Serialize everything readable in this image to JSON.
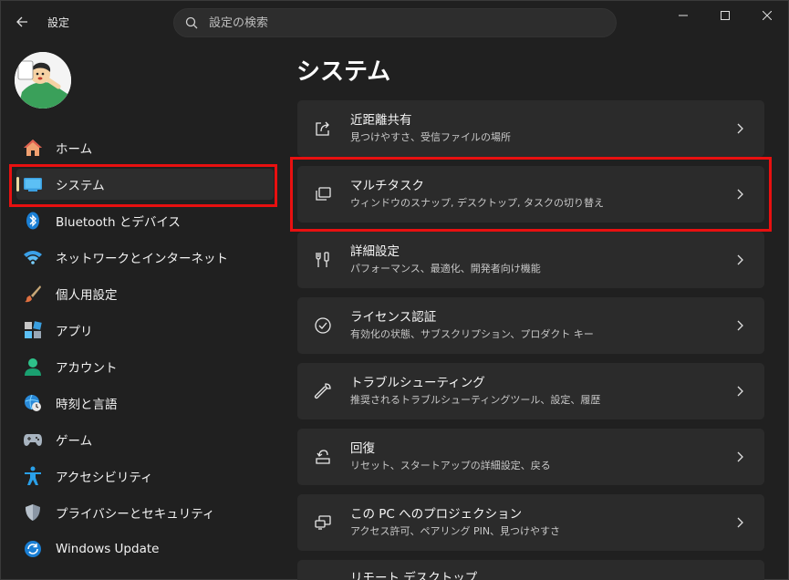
{
  "window": {
    "title": "設定",
    "search_placeholder": "設定の検索"
  },
  "sidebar": {
    "items": [
      {
        "label": "ホーム",
        "icon": "home-icon"
      },
      {
        "label": "システム",
        "icon": "system-monitor-icon",
        "selected": true
      },
      {
        "label": "Bluetooth とデバイス",
        "icon": "bluetooth-icon"
      },
      {
        "label": "ネットワークとインターネット",
        "icon": "wifi-icon"
      },
      {
        "label": "個人用設定",
        "icon": "brush-icon"
      },
      {
        "label": "アプリ",
        "icon": "apps-icon"
      },
      {
        "label": "アカウント",
        "icon": "account-icon"
      },
      {
        "label": "時刻と言語",
        "icon": "globe-clock-icon"
      },
      {
        "label": "ゲーム",
        "icon": "gamepad-icon"
      },
      {
        "label": "アクセシビリティ",
        "icon": "accessibility-icon"
      },
      {
        "label": "プライバシーとセキュリティ",
        "icon": "shield-icon"
      },
      {
        "label": "Windows Update",
        "icon": "update-icon"
      }
    ]
  },
  "main": {
    "title": "システム",
    "cards": [
      {
        "title": "近距離共有",
        "subtitle": "見つけやすさ、受信ファイルの場所",
        "icon": "share-icon"
      },
      {
        "title": "マルチタスク",
        "subtitle": "ウィンドウのスナップ, デスクトップ, タスクの切り替え",
        "icon": "multitask-icon"
      },
      {
        "title": "詳細設定",
        "subtitle": "パフォーマンス、最適化、開発者向け機能",
        "icon": "tools-icon"
      },
      {
        "title": "ライセンス認証",
        "subtitle": "有効化の状態、サブスクリプション、プロダクト キー",
        "icon": "check-circle-icon"
      },
      {
        "title": "トラブルシューティング",
        "subtitle": "推奨されるトラブルシューティングツール、設定、履歴",
        "icon": "wrench-icon"
      },
      {
        "title": "回復",
        "subtitle": "リセット、スタートアップの詳細設定、戻る",
        "icon": "recovery-icon"
      },
      {
        "title": "この PC へのプロジェクション",
        "subtitle": "アクセス許可、ペアリング PIN、見つけやすさ",
        "icon": "projection-icon"
      },
      {
        "title": "リモート デスクトップ",
        "subtitle": "",
        "icon": "remote-desktop-icon"
      }
    ]
  },
  "colors": {
    "background": "#202020",
    "card": "#2b2b2b",
    "highlight": "#e81010",
    "accent": "#4cc2ff"
  }
}
